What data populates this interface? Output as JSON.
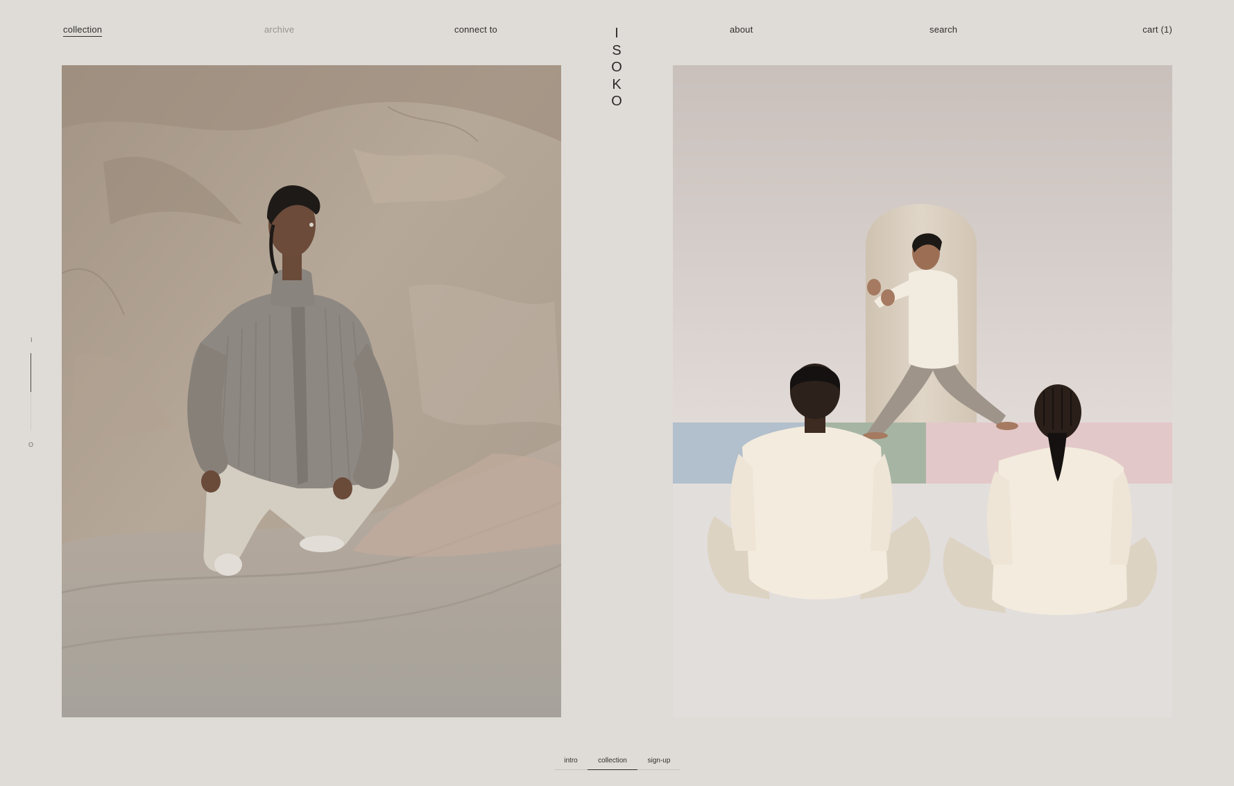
{
  "nav": {
    "collection": "collection",
    "archive": "archive",
    "connect": "connect to",
    "about": "about",
    "search": "search",
    "cart": "cart (1)"
  },
  "logo": {
    "letters": [
      "I",
      "S",
      "O",
      "K",
      "O"
    ]
  },
  "progress": {
    "top_label": "I",
    "bottom_label": "O",
    "fraction": 0.5
  },
  "tabs": {
    "intro": "intro",
    "collection": "collection",
    "signup": "sign-up",
    "active": "collection"
  },
  "colors": {
    "background": "#dfdcd7",
    "text": "#2f2e2b",
    "muted_text": "#96938d"
  }
}
